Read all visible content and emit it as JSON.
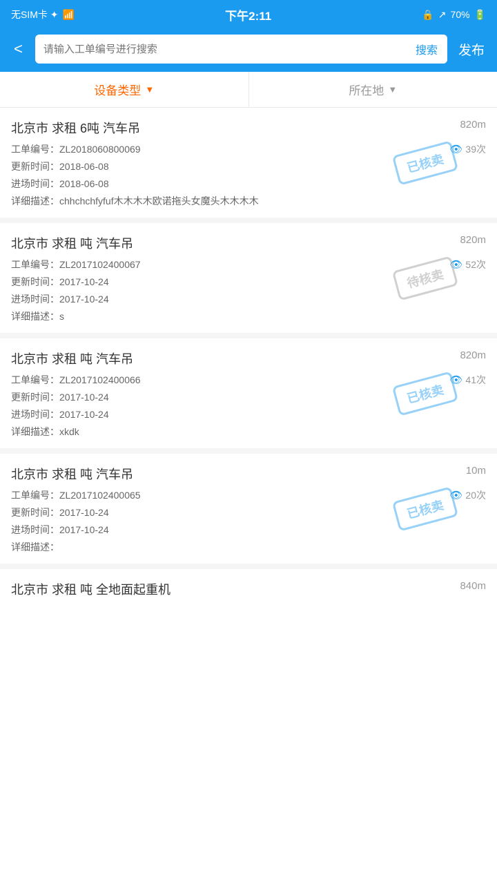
{
  "statusBar": {
    "left": "无SIM卡 ✦",
    "wifi": "▲",
    "time": "下午2:11",
    "lock": "🔒",
    "direction": "➤",
    "battery": "70%"
  },
  "header": {
    "back": "<",
    "searchPlaceholder": "请输入工单编号进行搜索",
    "searchBtn": "搜索",
    "publishBtn": "发布"
  },
  "filter": {
    "type": {
      "label": "设备类型",
      "active": true
    },
    "location": {
      "label": "所在地",
      "active": false
    }
  },
  "items": [
    {
      "title": "北京市 求租 6吨 汽车吊",
      "distance": "820m",
      "orderNo": "工单编号：ZL2018060800069",
      "views": "39次",
      "updateTime": "更新时间：2018-06-08",
      "entryTime": "进场时间：2018-06-08",
      "desc": "详细描述：chhchchfyfuf木木木木欧诺拖头女魔头木木木木",
      "stamp": "已核卖",
      "stampType": "sold"
    },
    {
      "title": "北京市 求租 吨 汽车吊",
      "distance": "820m",
      "orderNo": "工单编号：ZL2017102400067",
      "views": "52次",
      "updateTime": "更新时间：2017-10-24",
      "entryTime": "进场时间：2017-10-24",
      "desc": "详细描述：s",
      "stamp": "待核卖",
      "stampType": "pending"
    },
    {
      "title": "北京市 求租 吨 汽车吊",
      "distance": "820m",
      "orderNo": "工单编号：ZL2017102400066",
      "views": "41次",
      "updateTime": "更新时间：2017-10-24",
      "entryTime": "进场时间：2017-10-24",
      "desc": "详细描述：xkdk",
      "stamp": "已核卖",
      "stampType": "sold"
    },
    {
      "title": "北京市 求租 吨 汽车吊",
      "distance": "10m",
      "orderNo": "工单编号：ZL2017102400065",
      "views": "20次",
      "updateTime": "更新时间：2017-10-24",
      "entryTime": "进场时间：2017-10-24",
      "desc": "详细描述：",
      "stamp": "已核卖",
      "stampType": "sold"
    },
    {
      "title": "北京市 求租 吨 全地面起重机",
      "distance": "840m",
      "orderNo": "",
      "views": "",
      "updateTime": "",
      "entryTime": "",
      "desc": "",
      "stamp": "",
      "stampType": ""
    }
  ]
}
